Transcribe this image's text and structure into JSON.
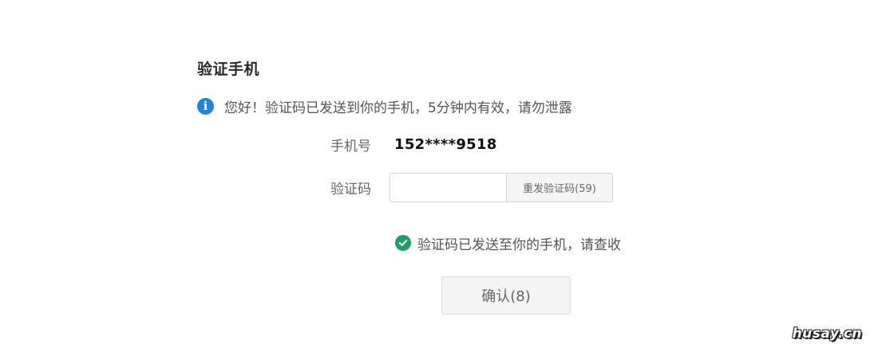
{
  "page": {
    "title": "验证手机"
  },
  "notice": {
    "icon": "info-icon",
    "icon_glyph": "i",
    "icon_color": "#1a86e0",
    "text": "您好！验证码已发送到你的手机，5分钟内有效，请勿泄露"
  },
  "phone_row": {
    "label": "手机号",
    "value": "152****9518"
  },
  "code_row": {
    "label": "验证码",
    "input_value": "",
    "input_placeholder": "",
    "resend_label": "重发验证码(59)"
  },
  "status": {
    "icon": "check-circle-icon",
    "icon_color": "#1aa260",
    "text": "验证码已发送至你的手机，请查收"
  },
  "confirm": {
    "label": "确认(8)"
  },
  "watermark": {
    "text": "husay.cn"
  }
}
